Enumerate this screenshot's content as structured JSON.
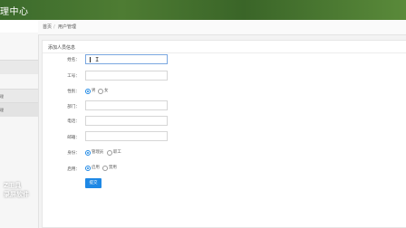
{
  "header": {
    "title": "理中心"
  },
  "sidebar": {
    "items": [
      {
        "label": "理"
      },
      {
        "label": "理"
      }
    ]
  },
  "breadcrumb": {
    "home": "首页",
    "separator": "/",
    "current": "用户管理"
  },
  "panel": {
    "title": "添加人员信息"
  },
  "form": {
    "name_label": "姓名：",
    "id_label": "工号：",
    "gender_label": "性别：",
    "gender_options": [
      "男",
      "女"
    ],
    "gender_selected": "男",
    "dept_label": "部门：",
    "phone_label": "电话：",
    "email_label": "邮箱：",
    "role_label": "身份：",
    "role_options": [
      "管理员",
      "职工"
    ],
    "role_selected": "管理员",
    "status_label": "启用：",
    "status_options": [
      "启用",
      "禁用"
    ],
    "status_selected": "启用",
    "submit_label": "提交"
  },
  "watermark": {
    "line1": "Z工具",
    "line2": "录屏软件"
  },
  "colors": {
    "header": "#4a7a30",
    "primary": "#1e88e5"
  }
}
